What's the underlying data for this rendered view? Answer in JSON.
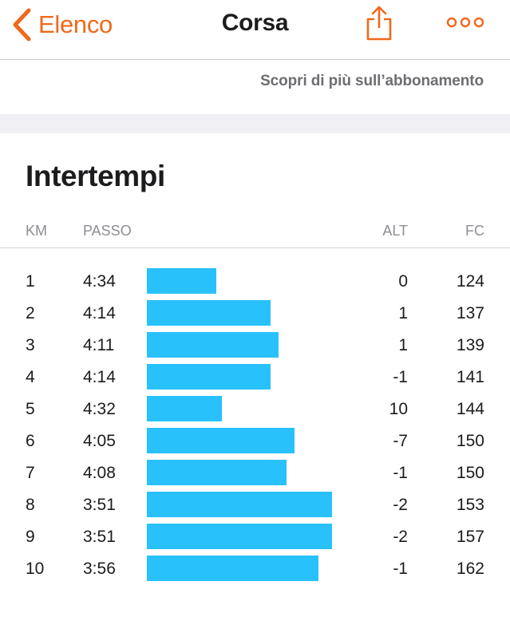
{
  "colors": {
    "accent": "#f0681c",
    "bar": "#28c1fb",
    "separator": "#c8c7cc",
    "promo_text": "#6d6d72",
    "background_gap": "#efeff4"
  },
  "nav": {
    "back_icon": "chevron-left-icon",
    "back_label": "Elenco",
    "title": "Corsa",
    "share_icon": "share-icon",
    "more_icon": "ellipsis-icon"
  },
  "promo": {
    "link_text": "Scopri di più sull’abbonamento"
  },
  "splits": {
    "title": "Intertempi",
    "columns": {
      "km": "KM",
      "pace": "PASSO",
      "alt": "ALT",
      "hr": "FC"
    },
    "rows": [
      {
        "km": "1",
        "pace": "4:34",
        "alt": "0",
        "hr": "124"
      },
      {
        "km": "2",
        "pace": "4:14",
        "alt": "1",
        "hr": "137"
      },
      {
        "km": "3",
        "pace": "4:11",
        "alt": "1",
        "hr": "139"
      },
      {
        "km": "4",
        "pace": "4:14",
        "alt": "-1",
        "hr": "141"
      },
      {
        "km": "5",
        "pace": "4:32",
        "alt": "10",
        "hr": "144"
      },
      {
        "km": "6",
        "pace": "4:05",
        "alt": "-7",
        "hr": "150"
      },
      {
        "km": "7",
        "pace": "4:08",
        "alt": "-1",
        "hr": "150"
      },
      {
        "km": "8",
        "pace": "3:51",
        "alt": "-2",
        "hr": "153"
      },
      {
        "km": "9",
        "pace": "3:51",
        "alt": "-2",
        "hr": "157"
      },
      {
        "km": "10",
        "pace": "3:56",
        "alt": "-1",
        "hr": "162"
      }
    ]
  }
}
